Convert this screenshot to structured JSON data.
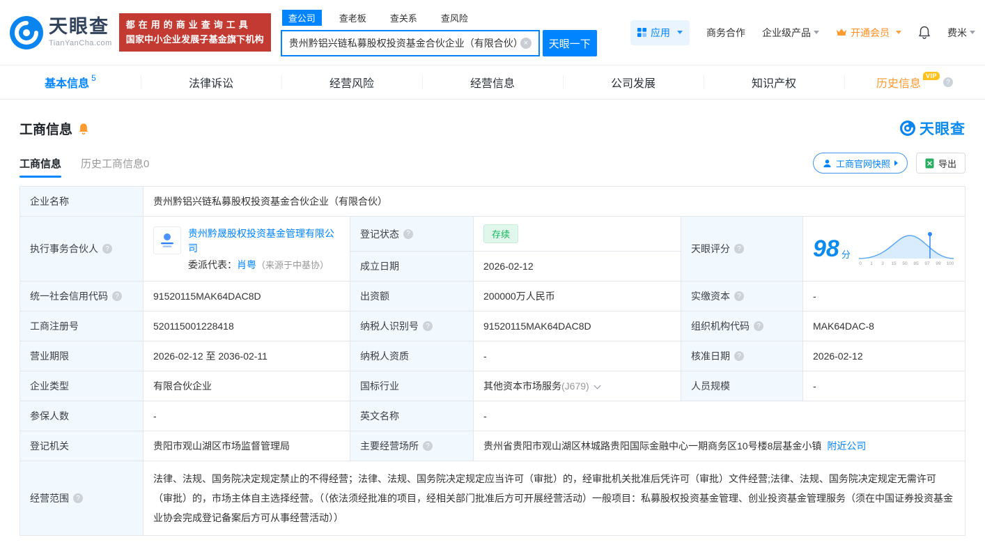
{
  "header": {
    "logo": {
      "name": "天眼查",
      "domain": "TianYanCha.com"
    },
    "promo": {
      "line1": "都在用的商业查询工具",
      "line2": "国家中小企业发展子基金旗下机构"
    },
    "search": {
      "tabs": [
        "查公司",
        "查老板",
        "查关系",
        "查风险"
      ],
      "value": "贵州黔铝兴链私募股权投资基金合伙企业（有限合伙）",
      "button_label": "天眼一下"
    },
    "menu": {
      "apps": "应用",
      "cooperation": "商务合作",
      "enterprise": "企业级产品",
      "vip": "开通会员",
      "user": "费米"
    }
  },
  "nav": {
    "tabs": [
      {
        "label": "基本信息",
        "count": "5"
      },
      {
        "label": "法律诉讼"
      },
      {
        "label": "经营风险"
      },
      {
        "label": "经营信息"
      },
      {
        "label": "公司发展"
      },
      {
        "label": "知识产权"
      },
      {
        "label": "历史信息",
        "badge": "VIP"
      }
    ]
  },
  "section": {
    "title": "工商信息",
    "brand": "天眼查",
    "subtabs": [
      "工商信息",
      "历史工商信息0"
    ],
    "snapshot_button": "工商官网快照",
    "export_button": "导出"
  },
  "info": {
    "company_name": {
      "label": "企业名称",
      "value": "贵州黔铝兴链私募股权投资基金合伙企业（有限合伙）"
    },
    "partner": {
      "label": "执行事务合伙人",
      "company": "贵州黔晟股权投资基金管理有限公司",
      "rep_label": "委派代表：",
      "rep_name": "肖粤",
      "rep_source": "（来源于中基协）"
    },
    "reg_status": {
      "label": "登记状态",
      "value": "存续"
    },
    "establish_date": {
      "label": "成立日期",
      "value": "2026-02-12"
    },
    "score": {
      "label": "天眼评分",
      "value": "98",
      "unit": "分",
      "axis": [
        "0",
        "1",
        "3",
        "15",
        "50",
        "85",
        "97",
        "99",
        "100"
      ]
    },
    "credit_code": {
      "label": "统一社会信用代码",
      "value": "91520115MAK64DAC8D"
    },
    "capital": {
      "label": "出资额",
      "value": "200000万人民币"
    },
    "paid_capital": {
      "label": "实缴资本",
      "value": "-"
    },
    "reg_no": {
      "label": "工商注册号",
      "value": "520115001228418"
    },
    "taxpayer_no": {
      "label": "纳税人识别号",
      "value": "91520115MAK64DAC8D"
    },
    "org_code": {
      "label": "组织机构代码",
      "value": "MAK64DAC-8"
    },
    "term": {
      "label": "营业期限",
      "value": "2026-02-12 至 2036-02-11"
    },
    "taxpayer_quality": {
      "label": "纳税人资质",
      "value": "-"
    },
    "approve_date": {
      "label": "核准日期",
      "value": "2026-02-12"
    },
    "company_type": {
      "label": "企业类型",
      "value": "有限合伙企业"
    },
    "industry": {
      "label": "国标行业",
      "value": "其他资本市场服务",
      "code": "(J679)"
    },
    "staff_size": {
      "label": "人员规模",
      "value": "-"
    },
    "insured": {
      "label": "参保人数",
      "value": "-"
    },
    "english_name": {
      "label": "英文名称",
      "value": "-"
    },
    "authority": {
      "label": "登记机关",
      "value": "贵阳市观山湖区市场监督管理局"
    },
    "address": {
      "label": "主要经营场所",
      "value": "贵州省贵阳市观山湖区林城路贵阳国际金融中心一期商务区10号楼8层基金小镇",
      "link": "附近公司"
    },
    "scope": {
      "label": "经营范围",
      "value": "法律、法规、国务院决定规定禁止的不得经营；法律、法规、国务院决定规定应当许可（审批）的，经审批机关批准后凭许可（审批）文件经营;法律、法规、国务院决定规定无需许可（审批）的，市场主体自主选择经营。（（依法须经批准的项目，经相关部门批准后方可开展经营活动）一般项目：私募股权投资基金管理、创业投资基金管理服务（须在中国证券投资基金业协会完成登记备案后方可从事经营活动））"
    }
  },
  "colors": {
    "primary": "#0084ff",
    "brand_red": "#c23a32",
    "status_green": "#12b75f",
    "vip_orange": "#ff9a2e"
  }
}
